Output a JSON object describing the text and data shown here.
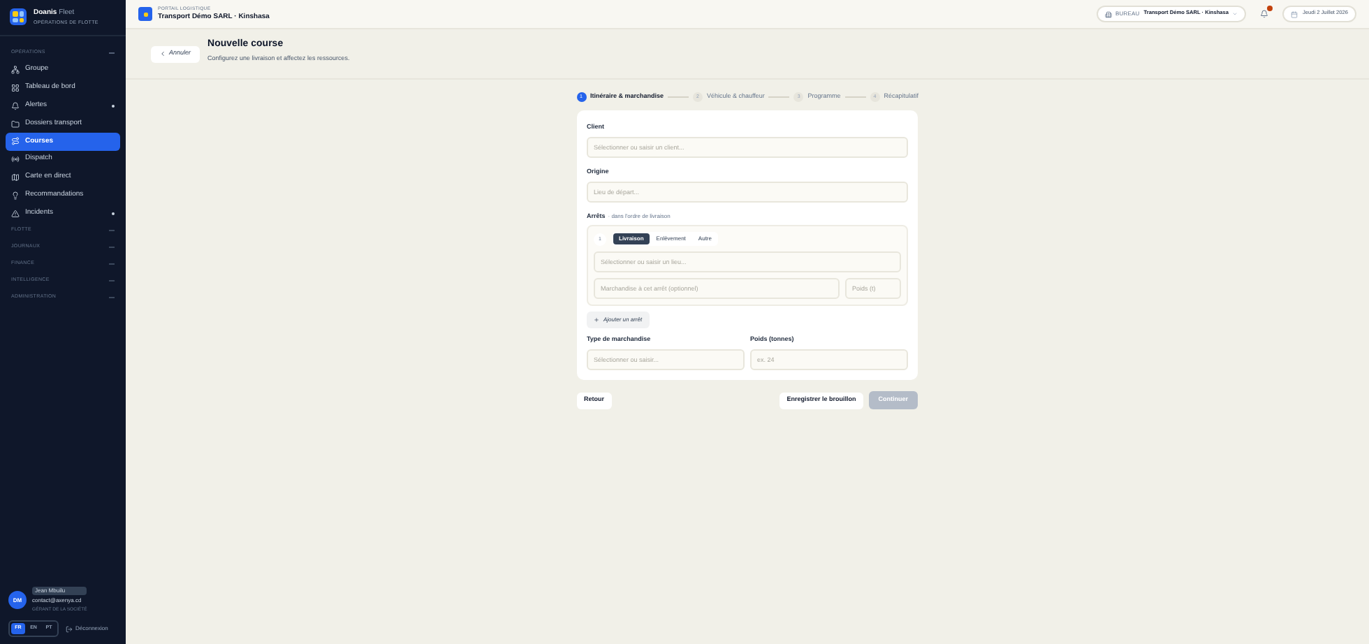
{
  "brand": {
    "name": "Doanis",
    "suffix": "Fleet",
    "subtitle": "OPÉRATIONS DE FLOTTE"
  },
  "sidebar": {
    "sections": [
      {
        "title": "OPÉRATIONS",
        "expanded": true,
        "items": [
          {
            "label": "Groupe",
            "selected": false,
            "dot": false
          },
          {
            "label": "Tableau de bord",
            "selected": false,
            "dot": false
          },
          {
            "label": "Alertes",
            "selected": false,
            "dot": true
          },
          {
            "label": "Dossiers transport",
            "selected": false,
            "dot": false
          },
          {
            "label": "Courses",
            "selected": true,
            "dot": false
          },
          {
            "label": "Dispatch",
            "selected": false,
            "dot": false
          },
          {
            "label": "Carte en direct",
            "selected": false,
            "dot": false
          },
          {
            "label": "Recommandations",
            "selected": false,
            "dot": false
          },
          {
            "label": "Incidents",
            "selected": false,
            "dot": true
          }
        ]
      },
      {
        "title": "FLOTTE",
        "expanded": false
      },
      {
        "title": "JOURNAUX",
        "expanded": false
      },
      {
        "title": "FINANCE",
        "expanded": false
      },
      {
        "title": "INTELLIGENCE",
        "expanded": false
      },
      {
        "title": "ADMINISTRATION",
        "expanded": false
      }
    ]
  },
  "user": {
    "initials": "DM",
    "name": "Jean Mbuilu",
    "email": "contact@axenya.cd",
    "role": "GÉRANT DE LA SOCIÉTÉ"
  },
  "languages": [
    {
      "label": "FR",
      "selected": true
    },
    {
      "label": "EN",
      "selected": false
    },
    {
      "label": "PT",
      "selected": false
    }
  ],
  "logout": "Déconnexion",
  "topbar": {
    "eyebrow": "PORTAIL LOGISTIQUE",
    "company": "Transport Démo SARL · Kinshasa",
    "office_label": "BUREAU",
    "office": "Transport Démo SARL · Kinshasa",
    "notification": true,
    "date": "Jeudi 2 Juillet 2026"
  },
  "page": {
    "back": "Annuler",
    "title": "Nouvelle course",
    "subtitle": "Configurez une livraison et affectez les ressources."
  },
  "steps": [
    {
      "number": "1",
      "label": "Itinéraire & marchandise",
      "selected": true
    },
    {
      "number": "2",
      "label": "Véhicule & chauffeur",
      "selected": false
    },
    {
      "number": "3",
      "label": "Programme",
      "selected": false
    },
    {
      "number": "4",
      "label": "Récapitulatif",
      "selected": false
    }
  ],
  "form": {
    "client": {
      "label": "Client",
      "placeholder": "Sélectionner ou saisir un client..."
    },
    "origin": {
      "label": "Origine",
      "placeholder": "Lieu de départ..."
    },
    "stops": {
      "label": "Arrêts",
      "hint": "· dans l'ordre de livraison",
      "items": [
        {
          "number": "1",
          "types": [
            {
              "label": "Livraison",
              "selected": true
            },
            {
              "label": "Enlèvement",
              "selected": false
            },
            {
              "label": "Autre",
              "selected": false
            }
          ],
          "place_placeholder": "Sélectionner ou saisir un lieu...",
          "goods_placeholder": "Marchandise à cet arrêt (optionnel)",
          "weight_placeholder": "Poids (t)"
        }
      ],
      "add": "Ajouter un arrêt"
    },
    "goods_type": {
      "label": "Type de marchandise",
      "placeholder": "Sélectionner ou saisir..."
    },
    "weight": {
      "label": "Poids (tonnes)",
      "placeholder": "ex. 24"
    }
  },
  "actions": {
    "back": "Retour",
    "draft": "Enregistrer le brouillon",
    "next": "Continuer",
    "next_disabled": true
  }
}
